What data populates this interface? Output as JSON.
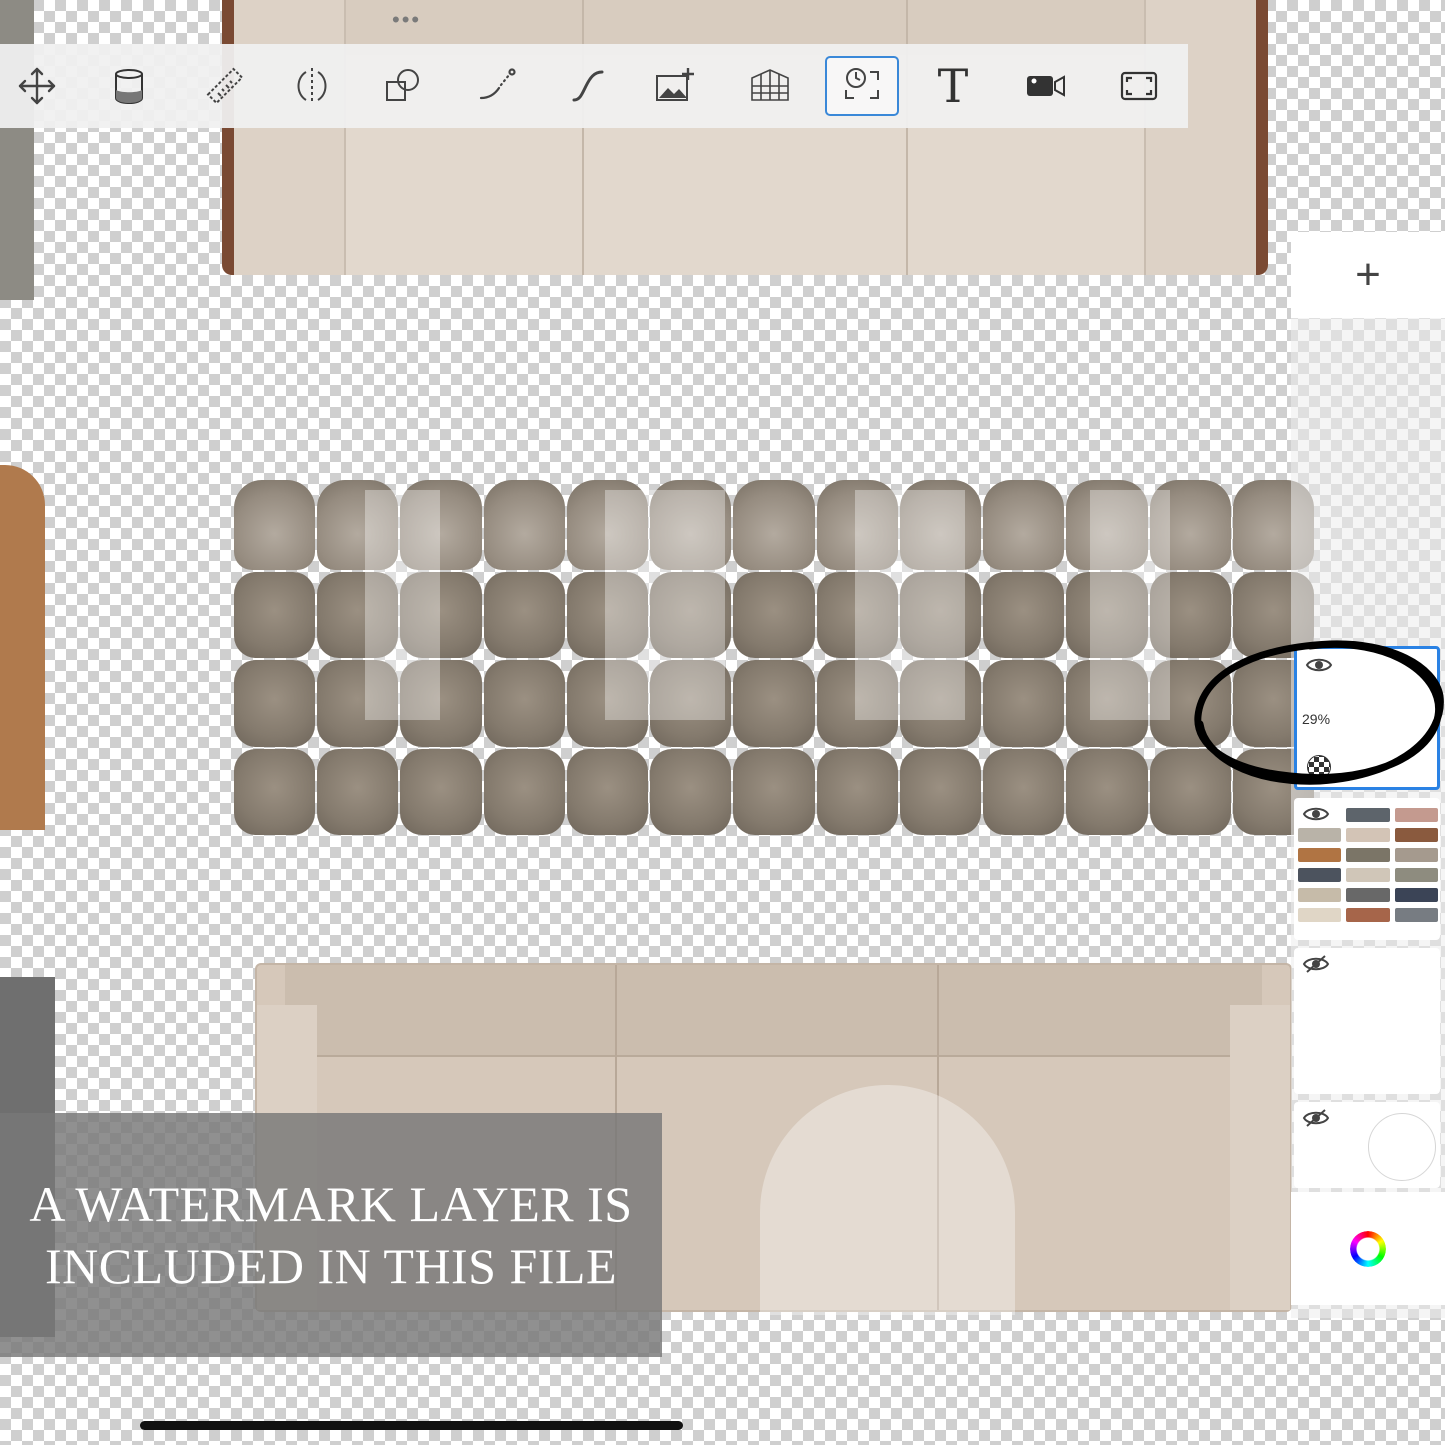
{
  "toolbar": {
    "more_icon": "more-dots-icon",
    "tools": [
      {
        "name": "move-tool",
        "icon": "move-arrows-icon"
      },
      {
        "name": "fill-tool",
        "icon": "paint-bucket-icon"
      },
      {
        "name": "measure-tool",
        "icon": "ruler-icon"
      },
      {
        "name": "symmetry-tool",
        "icon": "symmetry-icon"
      },
      {
        "name": "shape-tool",
        "icon": "shapes-icon"
      },
      {
        "name": "path-tool",
        "icon": "curve-dotted-icon"
      },
      {
        "name": "stroke-tool",
        "icon": "curve-icon"
      },
      {
        "name": "import-image-tool",
        "icon": "add-image-icon"
      },
      {
        "name": "perspective-grid-tool",
        "icon": "perspective-grid-icon"
      },
      {
        "name": "time-lapse-tool",
        "icon": "time-lapse-icon",
        "active": true
      },
      {
        "name": "text-tool",
        "icon": "text-icon"
      },
      {
        "name": "record-tool",
        "icon": "video-camera-icon"
      },
      {
        "name": "fullscreen-tool",
        "icon": "fullscreen-icon"
      }
    ]
  },
  "layers_panel": {
    "add_label": "+",
    "layers": [
      {
        "visible": true,
        "opacity": "29%",
        "selected": true
      },
      {
        "visible": true,
        "thumbnail": "sofa-swatches"
      },
      {
        "visible": false
      },
      {
        "visible": false
      }
    ],
    "color_icon": "color-wheel-icon"
  },
  "banner": {
    "line1": "A WATERMARK LAYER IS",
    "line2": "INCLUDED IN THIS FILE"
  },
  "colors": {
    "accent": "#2a82e4",
    "banner_bg": "#787878"
  }
}
